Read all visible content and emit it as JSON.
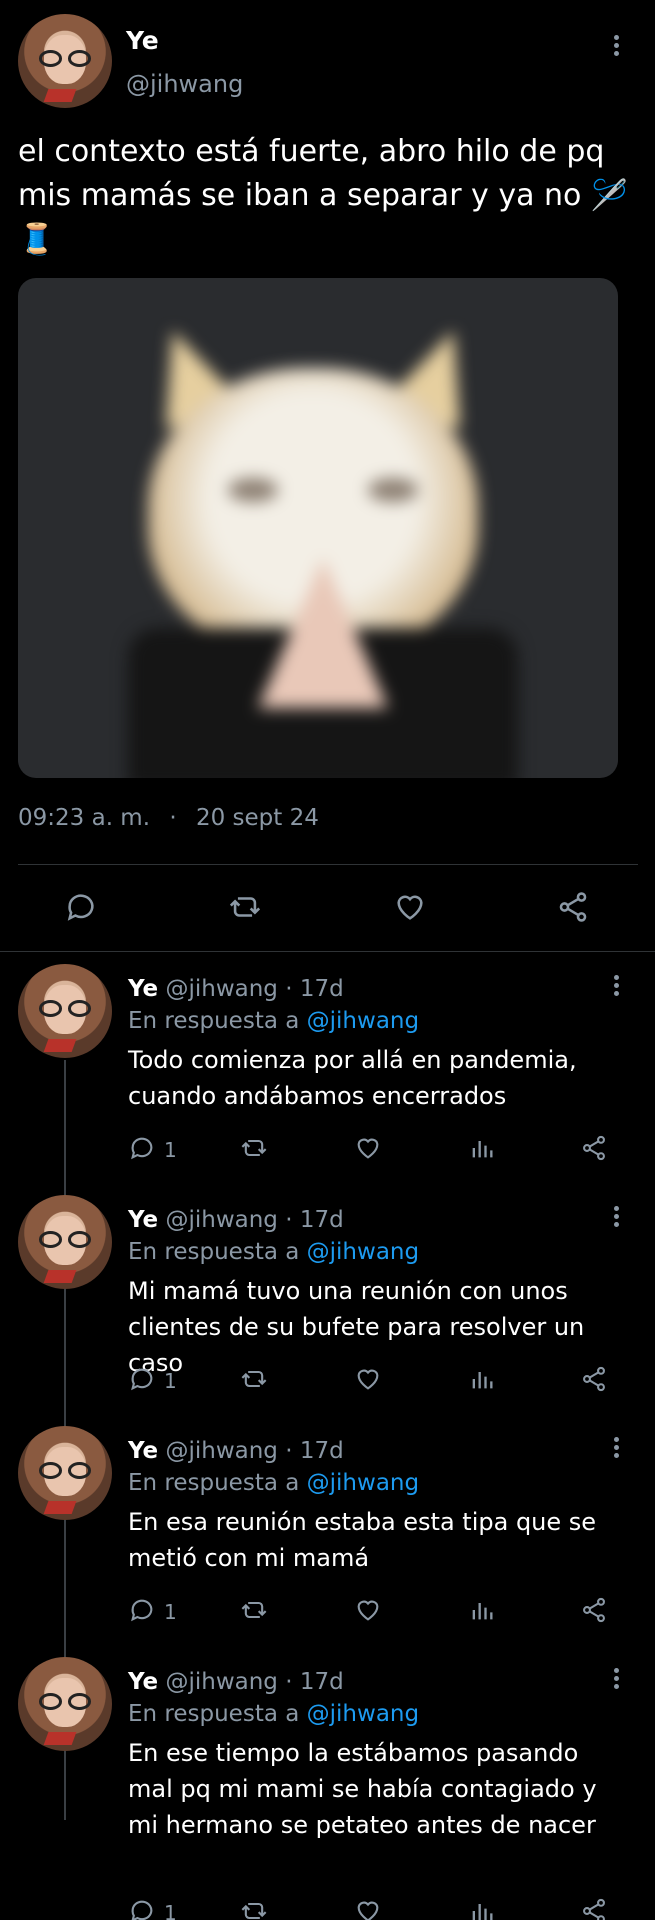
{
  "main_tweet": {
    "display_name": "Ye",
    "handle": "@jihwang",
    "text": "el contexto está fuerte, abro hilo de pq mis mamás se iban a separar y ya no 🪡🧵",
    "time": "09:23 a. m.",
    "separator": "·",
    "date": "20 sept 24",
    "icons": [
      "comment-icon",
      "retweet-icon",
      "heart-icon",
      "share-icon"
    ]
  },
  "replies": [
    {
      "display_name": "Ye",
      "handle": "@jihwang",
      "dot": "·",
      "age": "17d",
      "in_reply_prefix": "En respuesta a",
      "in_reply_mention": "@jihwang",
      "text": "Todo comienza por allá en pandemia, cuando andábamos encerrados",
      "reply_count": "1"
    },
    {
      "display_name": "Ye",
      "handle": "@jihwang",
      "dot": "·",
      "age": "17d",
      "in_reply_prefix": "En respuesta a",
      "in_reply_mention": "@jihwang",
      "text": "Mi mamá tuvo una reunión con unos clientes de su bufete para resolver un caso",
      "reply_count": "1"
    },
    {
      "display_name": "Ye",
      "handle": "@jihwang",
      "dot": "·",
      "age": "17d",
      "in_reply_prefix": "En respuesta a",
      "in_reply_mention": "@jihwang",
      "text": "En esa reunión estaba esta tipa que se metió con mi mamá",
      "reply_count": "1"
    },
    {
      "display_name": "Ye",
      "handle": "@jihwang",
      "dot": "·",
      "age": "17d",
      "in_reply_prefix": "En respuesta a",
      "in_reply_mention": "@jihwang",
      "text": "En ese tiempo la estábamos pasando mal pq mi mami se había contagiado y mi hermano se petateo antes de nacer",
      "reply_count": "1"
    }
  ],
  "colors": {
    "background": "#000000",
    "text": "#ffffff",
    "secondary": "#8b98a5",
    "link": "#1d9bf0"
  }
}
